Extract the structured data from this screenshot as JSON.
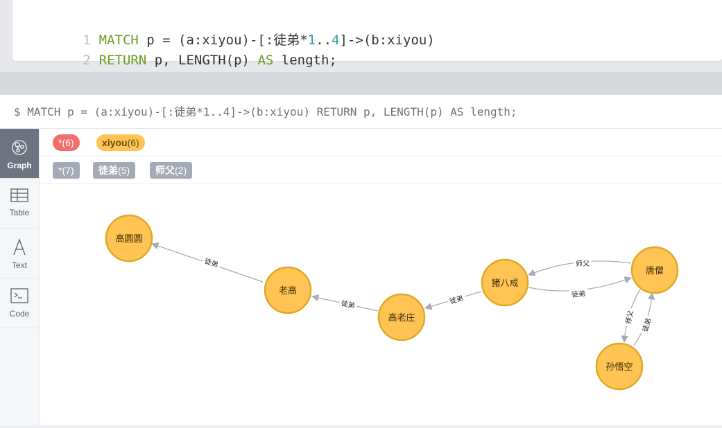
{
  "editor": {
    "line1_no": "1",
    "line1_kw": "MATCH",
    "line1_pre": " p = (a:xiyou)-[:徒弟*",
    "line1_num1": "1",
    "line1_dots": "..",
    "line1_num2": "4",
    "line1_post": "]->(b:xiyou)",
    "line2_no": "2",
    "line2_kw1": "RETURN",
    "line2_mid": " p, LENGTH(p) ",
    "line2_kw2": "AS",
    "line2_post": " length;"
  },
  "frame": {
    "query_echo": "$ MATCH p = (a:xiyou)-[:徒弟*1..4]->(b:xiyou) RETURN p, LENGTH(p) AS length;"
  },
  "sidebar": {
    "items": [
      {
        "label": "Graph",
        "icon": "graph-icon",
        "active": true
      },
      {
        "label": "Table",
        "icon": "table-icon"
      },
      {
        "label": "Text",
        "icon": "text-icon"
      },
      {
        "label": "Code",
        "icon": "code-icon"
      }
    ]
  },
  "legend": {
    "node_all": "*(6)",
    "node_xiyou_name": "xiyou",
    "node_xiyou_count": "(6)",
    "rel_all": "*(7)",
    "rel_tudi_name": "徒弟",
    "rel_tudi_count": "(5)",
    "rel_shifu_name": "师父",
    "rel_shifu_count": "(2)"
  },
  "colors": {
    "node_fill": "#ffc454",
    "node_stroke": "#e0a824",
    "edge": "#a5abb6",
    "red_tag": "#f06e6e"
  },
  "graph": {
    "nodes": [
      {
        "id": "gyy",
        "label": "高圆圆"
      },
      {
        "id": "lg",
        "label": "老高"
      },
      {
        "id": "glz",
        "label": "高老庄"
      },
      {
        "id": "zbj",
        "label": "猪八戒"
      },
      {
        "id": "ts",
        "label": "唐僧"
      },
      {
        "id": "swk",
        "label": "孙悟空"
      }
    ],
    "edges": [
      {
        "label": "徒弟"
      },
      {
        "label": "徒弟"
      },
      {
        "label": "徒弟"
      },
      {
        "label": "师父"
      },
      {
        "label": "徒弟"
      },
      {
        "label": "师父"
      },
      {
        "label": "徒弟"
      }
    ]
  }
}
